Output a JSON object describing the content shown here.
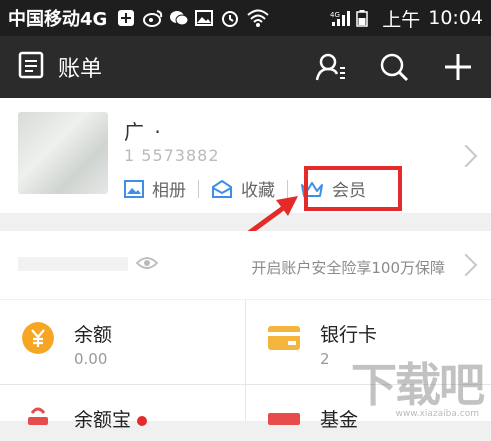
{
  "status_bar": {
    "carrier": "中国移动4G",
    "network": "4G",
    "time_prefix": "上午",
    "time": "10:04"
  },
  "app_bar": {
    "title": "账单"
  },
  "profile": {
    "name": "广 ·",
    "account": "1 5573882",
    "links": [
      "相册",
      "收藏",
      "会员"
    ]
  },
  "security": {
    "promo": "开启账户安全险享100万保障"
  },
  "grid": {
    "balance": {
      "title": "余额",
      "value": "0.00"
    },
    "bank_card": {
      "title": "银行卡",
      "value": "2"
    },
    "yuebao": {
      "title": "余额宝"
    },
    "fund": {
      "title": "基金"
    }
  },
  "watermark": {
    "text": "下载吧",
    "url": "www.xiazaiba.com"
  },
  "colors": {
    "accent_red": "#e52a2a",
    "link_blue": "#3d8ee8",
    "balance_orange": "#f6a623",
    "bank_yellow": "#f5b53d"
  }
}
